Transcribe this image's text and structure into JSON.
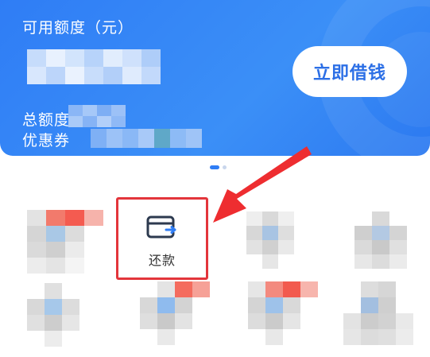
{
  "card": {
    "available_label": "可用额度（元）",
    "total_label": "总额度",
    "coupon_label": "优惠券",
    "borrow_button": "立即借钱",
    "accent_color": "#2f7df5"
  },
  "services": {
    "highlighted_item": {
      "label": "还款",
      "icon": "card-repay-icon"
    },
    "highlight_color": "#e3353b"
  },
  "carousel": {
    "pages": 2,
    "active": 1
  }
}
